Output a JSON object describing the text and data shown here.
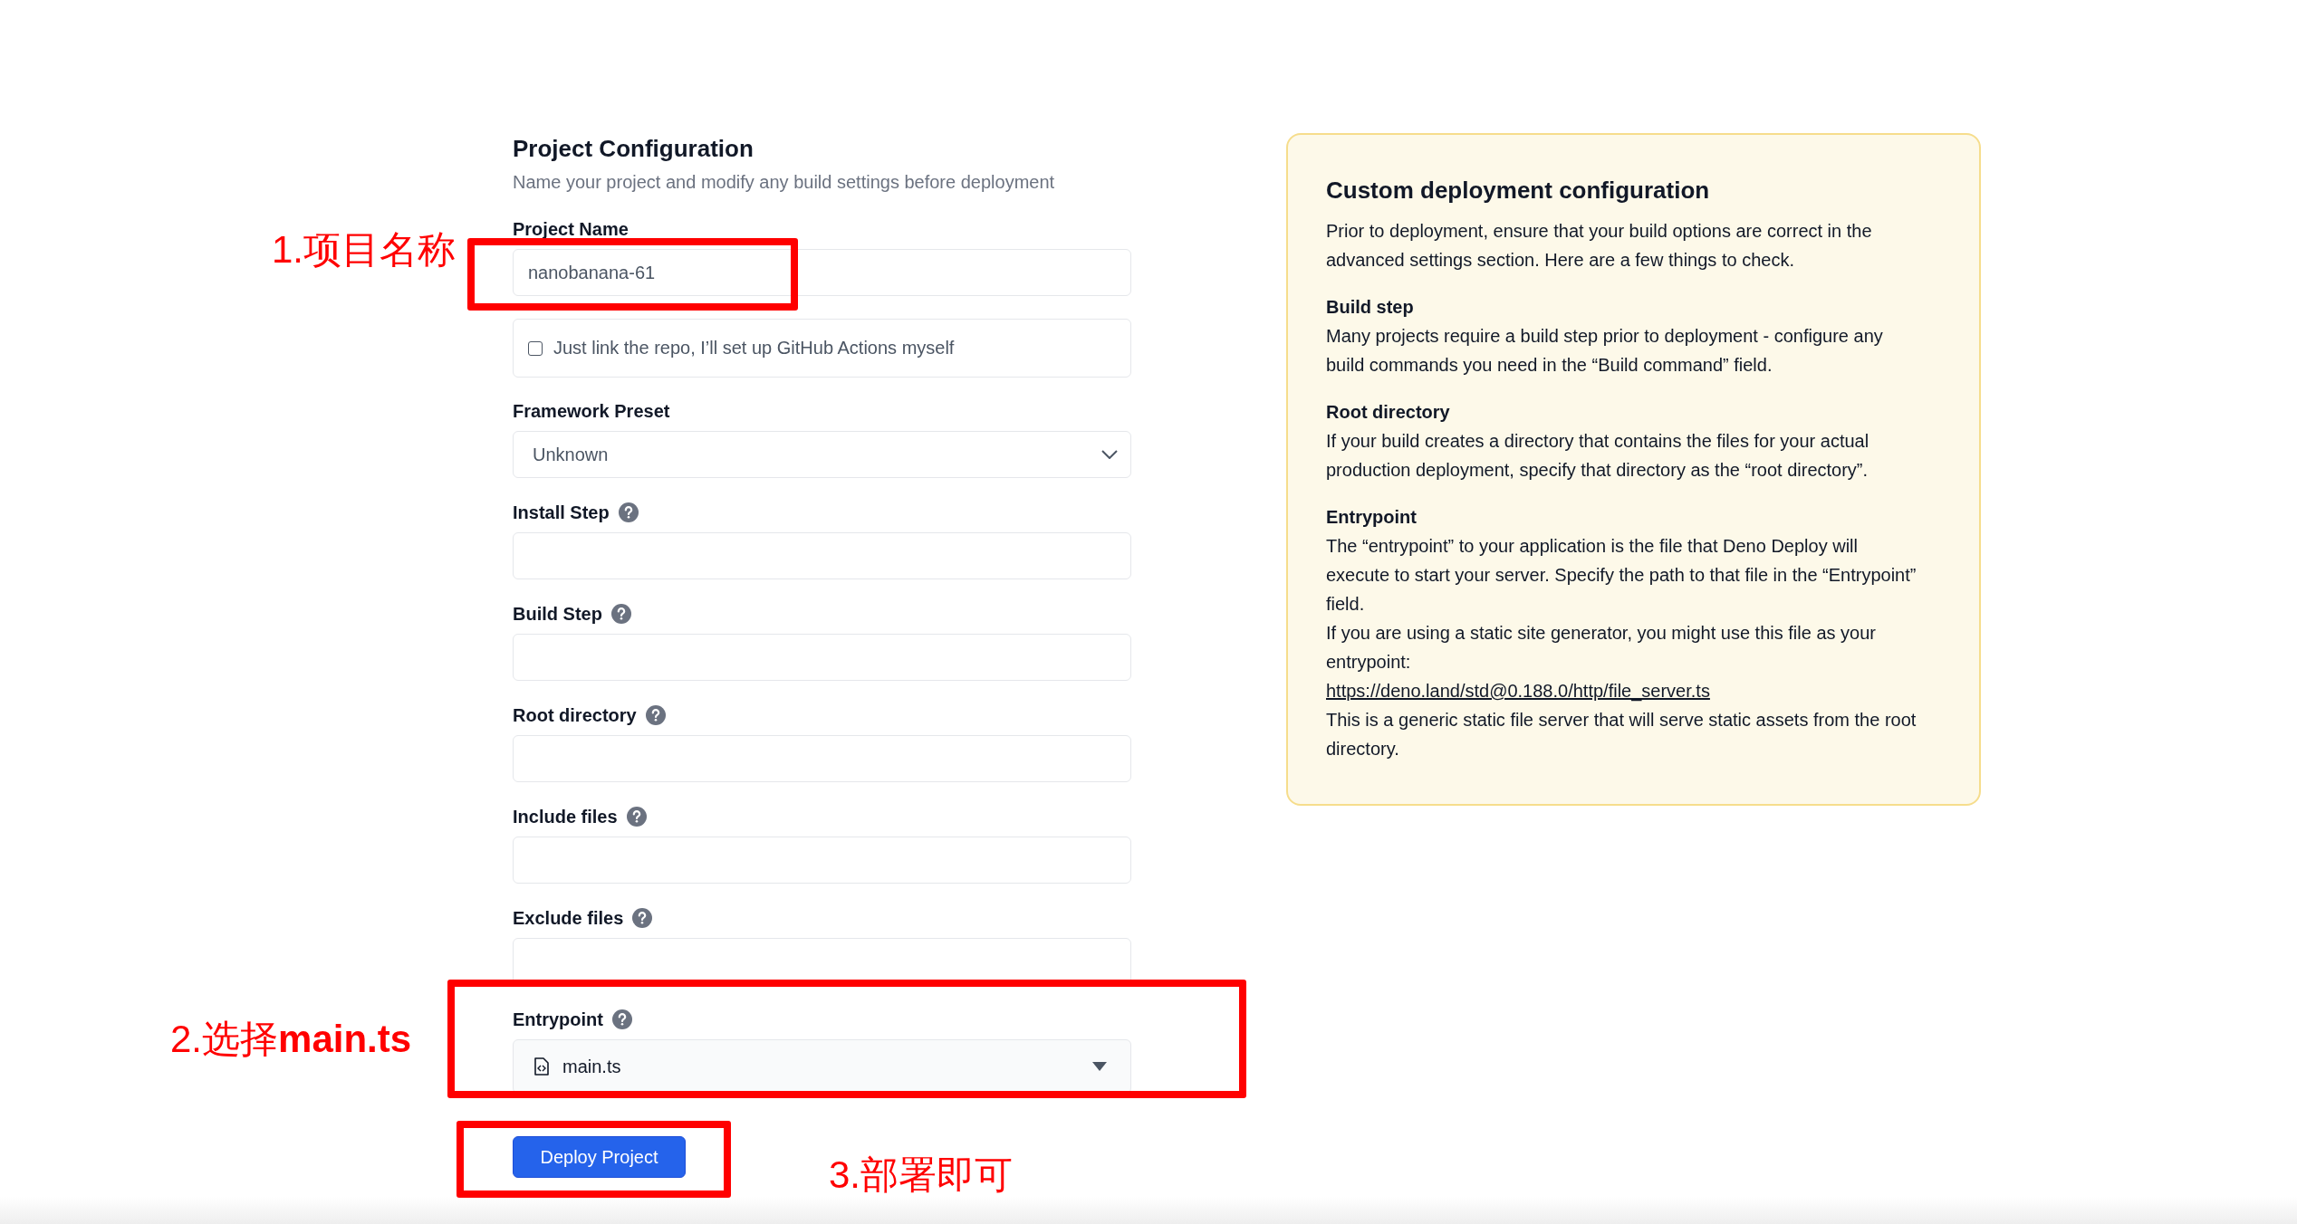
{
  "form": {
    "title": "Project Configuration",
    "subtitle": "Name your project and modify any build settings before deployment",
    "fields": [
      {
        "kind": "text",
        "label": "Project Name",
        "value": "nanobanana-61",
        "help": false
      },
      {
        "kind": "checkbox",
        "label": "Just link the repo, I’ll set up GitHub Actions myself",
        "checked": false
      },
      {
        "kind": "select",
        "label": "Framework Preset",
        "value": "Unknown",
        "help": false
      },
      {
        "kind": "text",
        "label": "Install Step",
        "help": true
      },
      {
        "kind": "text",
        "label": "Build Step",
        "help": true
      },
      {
        "kind": "text",
        "label": "Root directory",
        "help": true
      },
      {
        "kind": "text",
        "label": "Include files",
        "help": true
      },
      {
        "kind": "text",
        "label": "Exclude files",
        "help": true
      },
      {
        "kind": "file-select",
        "label": "Entrypoint",
        "value": "main.ts",
        "help": true
      }
    ],
    "submit": "Deploy Project"
  },
  "info_panel": {
    "title": "Custom deployment configuration",
    "intro": "Prior to deployment, ensure that your build options are correct in the advanced settings section. Here are a few things to check.",
    "sections": [
      {
        "heading": "Build step",
        "items": [
          {
            "kind": "text",
            "text": "Many projects require a build step prior to deployment - configure any build commands you need in the “Build command” field."
          }
        ]
      },
      {
        "heading": "Root directory",
        "items": [
          {
            "kind": "text",
            "text": "If your build creates a directory that contains the files for your actual production deployment, specify that directory as the “root directory”."
          }
        ]
      },
      {
        "heading": "Entrypoint",
        "items": [
          {
            "kind": "text",
            "text": "The “entrypoint” to your application is the file that Deno Deploy will execute to start your server. Specify the path to that file in the “Entrypoint” field."
          },
          {
            "kind": "text",
            "text": "If you are using a static site generator, you might use this file as your entrypoint:"
          },
          {
            "kind": "link",
            "text": "https://deno.land/std@0.188.0/http/file_server.ts"
          },
          {
            "kind": "text",
            "text": "This is a generic static file server that will serve static assets from the root directory."
          }
        ]
      }
    ]
  },
  "annotations": [
    {
      "text": "1.项目名称"
    },
    {
      "text": "2.选择**main.ts**"
    },
    {
      "text": "3.部署即可"
    }
  ]
}
